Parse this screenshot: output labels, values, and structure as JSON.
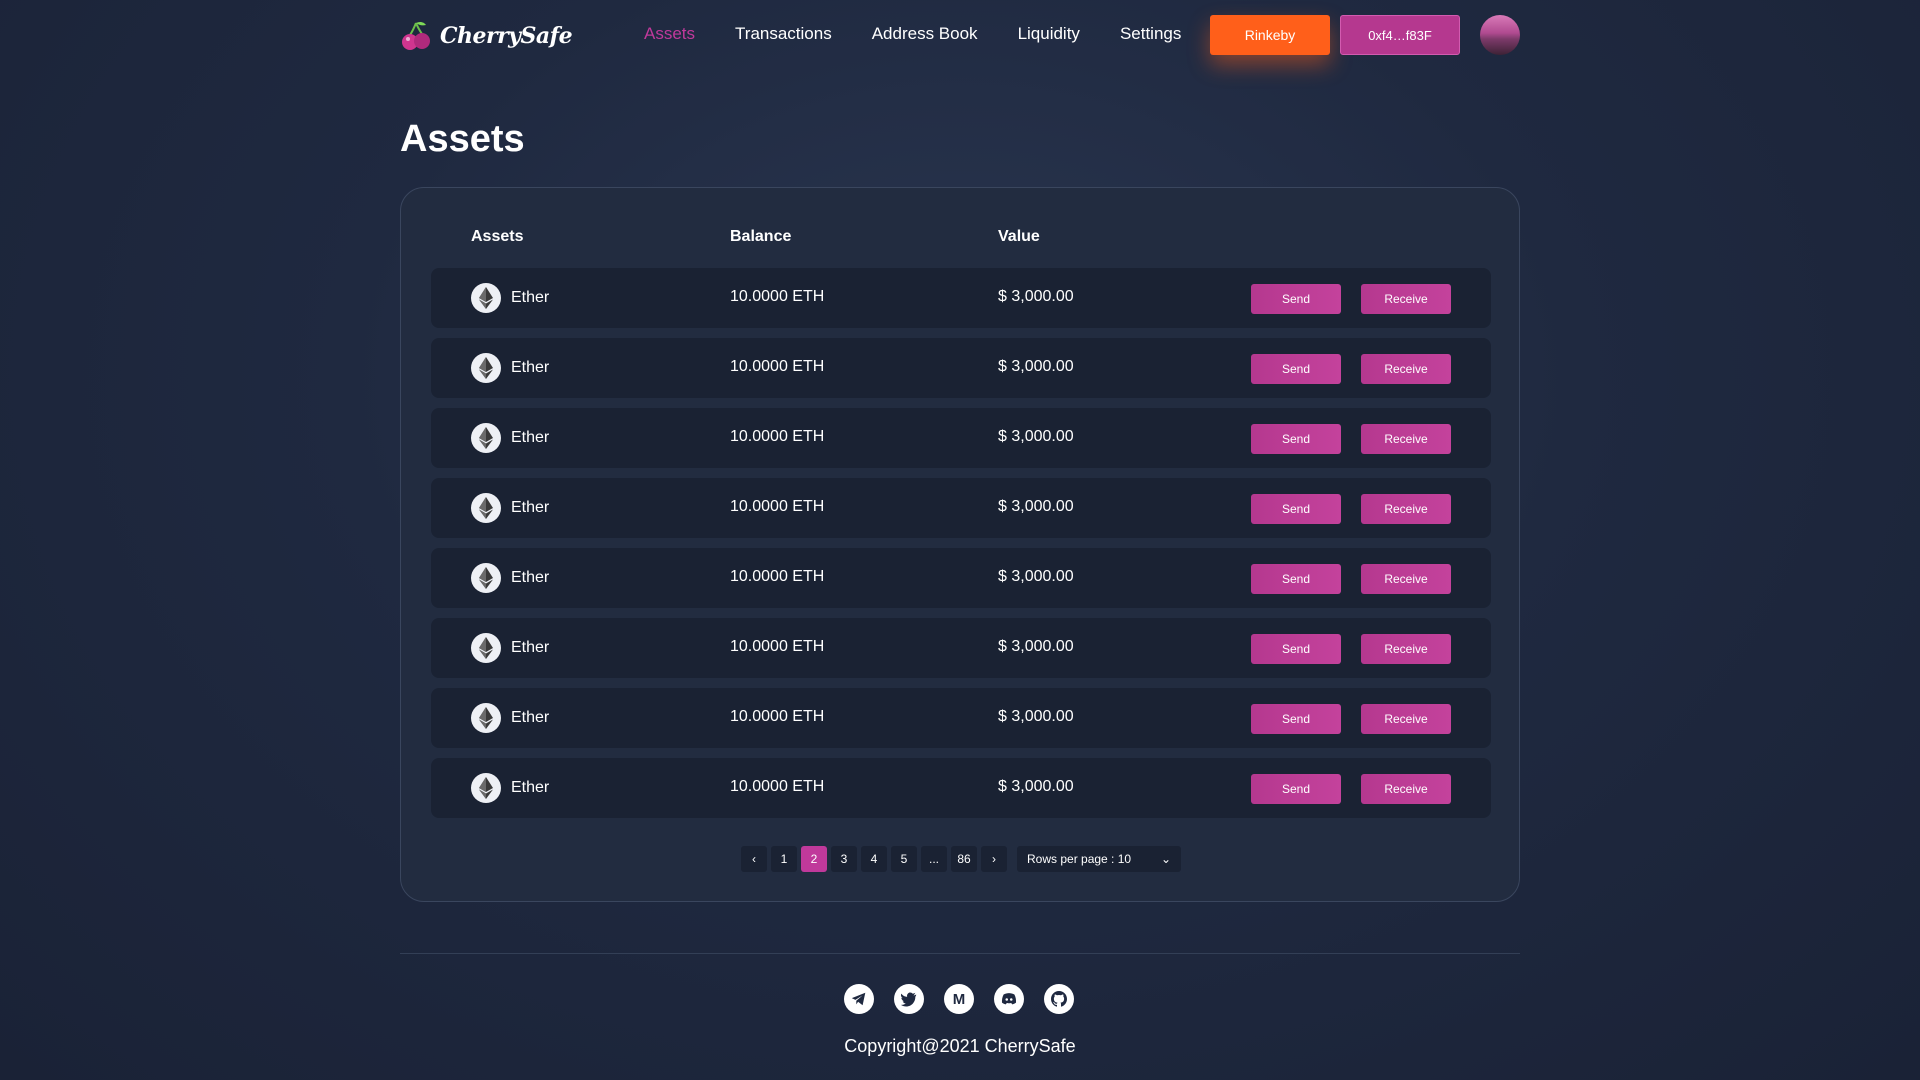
{
  "header": {
    "brand": "CherrySafe",
    "nav": [
      {
        "label": "Assets",
        "active": true
      },
      {
        "label": "Transactions",
        "active": false
      },
      {
        "label": "Address Book",
        "active": false
      },
      {
        "label": "Liquidity",
        "active": false
      },
      {
        "label": "Settings",
        "active": false
      }
    ],
    "network_label": "Rinkeby",
    "wallet_label": "0xf4…f83F"
  },
  "page_title": "Assets",
  "table": {
    "columns": [
      "Assets",
      "Balance",
      "Value"
    ],
    "rows": [
      {
        "asset": "Ether",
        "balance": "10.0000 ETH",
        "value": "$ 3,000.00",
        "send_label": "Send",
        "receive_label": "Receive"
      },
      {
        "asset": "Ether",
        "balance": "10.0000 ETH",
        "value": "$ 3,000.00",
        "send_label": "Send",
        "receive_label": "Receive"
      },
      {
        "asset": "Ether",
        "balance": "10.0000 ETH",
        "value": "$ 3,000.00",
        "send_label": "Send",
        "receive_label": "Receive"
      },
      {
        "asset": "Ether",
        "balance": "10.0000 ETH",
        "value": "$ 3,000.00",
        "send_label": "Send",
        "receive_label": "Receive"
      },
      {
        "asset": "Ether",
        "balance": "10.0000 ETH",
        "value": "$ 3,000.00",
        "send_label": "Send",
        "receive_label": "Receive"
      },
      {
        "asset": "Ether",
        "balance": "10.0000 ETH",
        "value": "$ 3,000.00",
        "send_label": "Send",
        "receive_label": "Receive"
      },
      {
        "asset": "Ether",
        "balance": "10.0000 ETH",
        "value": "$ 3,000.00",
        "send_label": "Send",
        "receive_label": "Receive"
      },
      {
        "asset": "Ether",
        "balance": "10.0000 ETH",
        "value": "$ 3,000.00",
        "send_label": "Send",
        "receive_label": "Receive"
      }
    ]
  },
  "pagination": {
    "prev": "‹",
    "pages": [
      "1",
      "2",
      "3",
      "4",
      "5",
      "...",
      "86"
    ],
    "current_page": "2",
    "next": "›",
    "rows_per_page": "Rows per page : 10"
  },
  "footer": {
    "socials": [
      "telegram-icon",
      "twitter-icon",
      "medium-icon",
      "discord-icon",
      "github-icon"
    ],
    "copyright": "Copyright@2021 CherrySafe"
  },
  "colors": {
    "accent": "#c0399b",
    "network_button": "#ff5f1a",
    "background": "#1f2940",
    "card": "#222c40",
    "row": "#1a2233"
  }
}
